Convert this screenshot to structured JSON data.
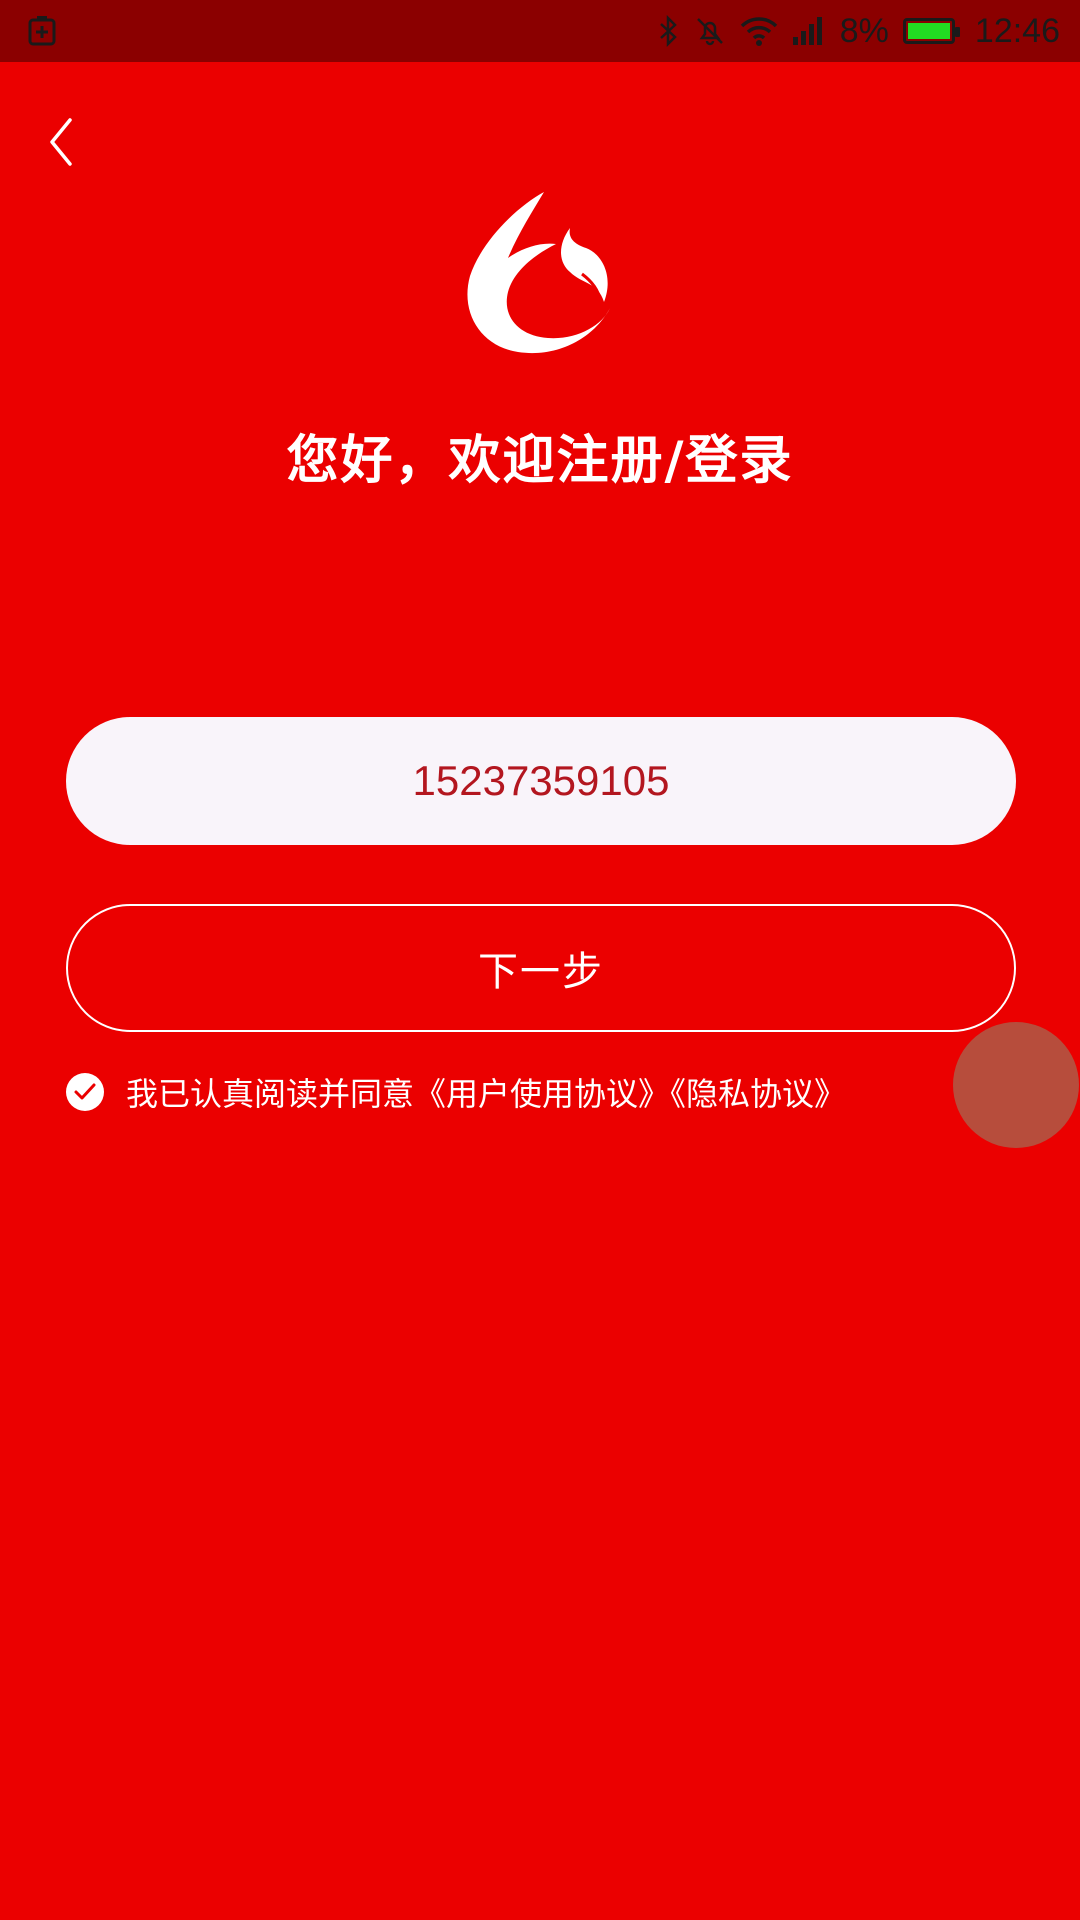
{
  "status_bar": {
    "battery_percent": "8%",
    "time": "12:46",
    "icons": [
      "battery-saver-icon",
      "bluetooth-icon",
      "mute-icon",
      "wifi-icon",
      "signal-icon",
      "battery-icon"
    ],
    "battery_level": 0.08,
    "battery_fill_color": "#22dd22"
  },
  "header": {
    "back_icon": "chevron-left-icon",
    "logo": "app-logo"
  },
  "main": {
    "title": "您好，欢迎注册/登录",
    "phone_value": "15237359105",
    "next_label": "下一步"
  },
  "agreement": {
    "prefix": "我已认真阅读并同意",
    "user_agreement": "《用户使用协议》",
    "privacy_policy": "《隐私协议》",
    "checked": true
  },
  "colors": {
    "background": "#eb0000",
    "status_bar": "#8b0000",
    "input_bg": "#f9f4fa",
    "input_text": "#b3161f",
    "foreground": "#ffffff"
  }
}
